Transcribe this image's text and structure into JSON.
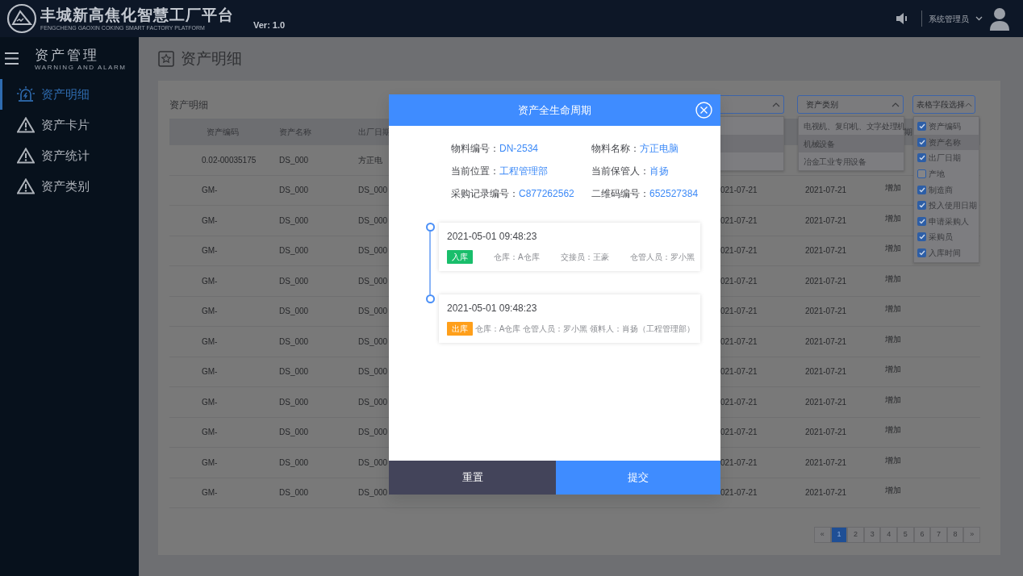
{
  "header": {
    "title": "丰城新高焦化智慧工厂平台",
    "subtitle": "FENGCHENG GAOXIN COKING SMART FACTORY PLATFORM",
    "version": "Ver: 1.0",
    "user": "系统管理员"
  },
  "sidebar": {
    "title": "资产管理",
    "subtitle": "WARNING AND ALARM",
    "items": [
      {
        "label": "资产明细",
        "kind": "alarm",
        "selected": true
      },
      {
        "label": "资产卡片",
        "kind": "warning",
        "selected": false
      },
      {
        "label": "资产统计",
        "kind": "warning",
        "selected": false
      },
      {
        "label": "资产类别",
        "kind": "warning",
        "selected": false
      }
    ]
  },
  "page_title": "资产明细",
  "panel": {
    "title": "资产明细",
    "filters": [
      {
        "kind": "select",
        "placeholder": "资产类别",
        "expanded": true,
        "options": [
          {
            "label": "电视机、复印机、文字处理机",
            "selected": false
          },
          {
            "label": "机械设备",
            "selected": true
          },
          {
            "label": "冶金工业专用设备",
            "selected": false
          }
        ]
      },
      {
        "kind": "fields",
        "placeholder": "表格字段选择",
        "expanded": true,
        "options": [
          {
            "label": "资产编码",
            "checked": true,
            "selected": false
          },
          {
            "label": "资产名称",
            "checked": true,
            "selected": true
          },
          {
            "label": "出厂日期",
            "checked": true,
            "selected": false
          },
          {
            "label": "产地",
            "checked": false,
            "selected": false
          },
          {
            "label": "制造商",
            "checked": true,
            "selected": false
          },
          {
            "label": "投入使用日期",
            "checked": true,
            "selected": false
          },
          {
            "label": "申请采购人",
            "checked": true,
            "selected": false
          },
          {
            "label": "采购员",
            "checked": true,
            "selected": false
          },
          {
            "label": "入库时间",
            "checked": true,
            "selected": false
          }
        ]
      }
    ],
    "table": {
      "columns": [
        "资产编码",
        "资产名称",
        "出厂日期"
      ],
      "column_7": "期",
      "rows": [
        {
          "left": [
            "0.02-00035175",
            "DS_000",
            "方正电"
          ],
          "right": []
        },
        {
          "left": [
            "GM-",
            "DS_000",
            "DS_000"
          ],
          "right": [
            "021-07-21",
            "2021-07-21",
            "增加"
          ]
        },
        {
          "left": [
            "GM-",
            "DS_000",
            "DS_000"
          ],
          "right": [
            "021-07-21",
            "2021-07-21",
            "增加"
          ]
        },
        {
          "left": [
            "GM-",
            "DS_000",
            "DS_000"
          ],
          "right": [
            "021-07-21",
            "2021-07-21",
            "增加"
          ]
        },
        {
          "left": [
            "GM-",
            "DS_000",
            "DS_000"
          ],
          "right": [
            "021-07-21",
            "2021-07-21",
            "增加"
          ]
        },
        {
          "left": [
            "GM-",
            "DS_000",
            "DS_000"
          ],
          "right": [
            "021-07-21",
            "2021-07-21",
            "增加"
          ]
        },
        {
          "left": [
            "GM-",
            "DS_000",
            "DS_000"
          ],
          "right": [
            "021-07-21",
            "2021-07-21",
            "增加"
          ]
        },
        {
          "left": [
            "GM-",
            "DS_000",
            "DS_000"
          ],
          "right": [
            "021-07-21",
            "2021-07-21",
            "增加"
          ]
        },
        {
          "left": [
            "GM-",
            "DS_000",
            "DS_000"
          ],
          "right": [
            "021-07-21",
            "2021-07-21",
            "增加"
          ]
        },
        {
          "left": [
            "GM-",
            "DS_000",
            "DS_000"
          ],
          "right": [
            "021-07-21",
            "2021-07-21",
            "增加"
          ]
        },
        {
          "left": [
            "GM-",
            "DS_000",
            "DS_000"
          ],
          "right": [
            "021-07-21",
            "2021-07-21",
            "增加"
          ]
        },
        {
          "left": [
            "GM-",
            "DS_000",
            "DS_000"
          ],
          "right": [
            "021-07-21",
            "2021-07-21",
            "增加"
          ]
        }
      ]
    },
    "pagination": {
      "prev": "«",
      "next": "»",
      "pages": [
        {
          "label": "1",
          "selected": true
        },
        {
          "label": "2",
          "selected": false
        },
        {
          "label": "3",
          "selected": false
        },
        {
          "label": "4",
          "selected": false
        },
        {
          "label": "5",
          "selected": false
        },
        {
          "label": "6",
          "selected": false
        },
        {
          "label": "7",
          "selected": false
        },
        {
          "label": "8",
          "selected": false
        }
      ]
    }
  },
  "modal": {
    "title": "资产全生命周期",
    "fields": [
      {
        "label": "物料编号：",
        "value": "DN-2534"
      },
      {
        "label": "物料名称：",
        "value": "方正电脑"
      },
      {
        "label": "当前位置：",
        "value": "工程管理部"
      },
      {
        "label": "当前保管人：",
        "value": "肖扬"
      },
      {
        "label": "采购记录编号：",
        "value": "C877262562"
      },
      {
        "label": "二维码编号：",
        "value": "652527384"
      }
    ],
    "timeline": [
      {
        "time": "2021-05-01 09:48:23",
        "tag": "入库",
        "kind": "in",
        "details": [
          "仓库：A仓库",
          "交接员：王豪",
          "仓管人员：罗小黑"
        ]
      },
      {
        "time": "2021-05-01 09:48:23",
        "tag": "出库",
        "kind": "out",
        "details": [
          "仓库：A仓库",
          "仓管人员：罗小黑",
          "领料人：肖扬（工程管理部）"
        ]
      }
    ],
    "buttons": [
      {
        "label": "重置",
        "kind": "secondary"
      },
      {
        "label": "提交",
        "kind": "primary"
      }
    ]
  }
}
